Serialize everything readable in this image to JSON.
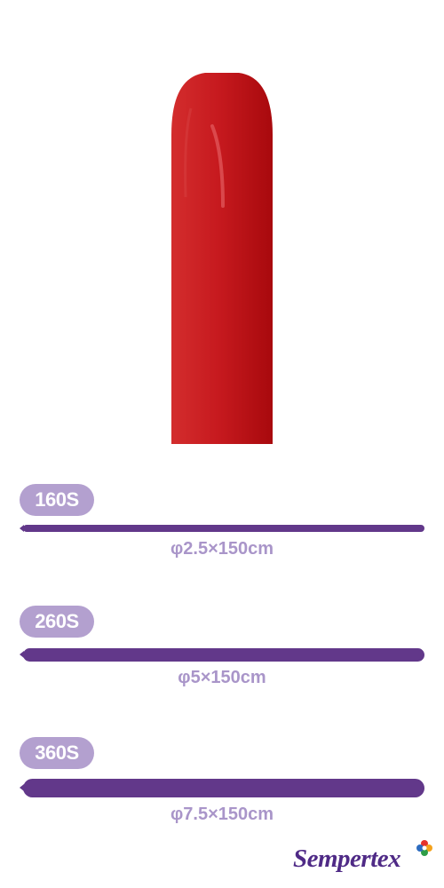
{
  "colors": {
    "balloon": "#c4161c",
    "badge": "#b3a0cf",
    "bar": "#62388a",
    "dimension_text": "#a995c9",
    "brand": "#4f2a86"
  },
  "sizes": [
    {
      "code": "160S",
      "dimension": "φ2.5×150cm"
    },
    {
      "code": "260S",
      "dimension": "φ5×150cm"
    },
    {
      "code": "360S",
      "dimension": "φ7.5×150cm"
    }
  ],
  "brand": {
    "name": "Sempertex"
  }
}
